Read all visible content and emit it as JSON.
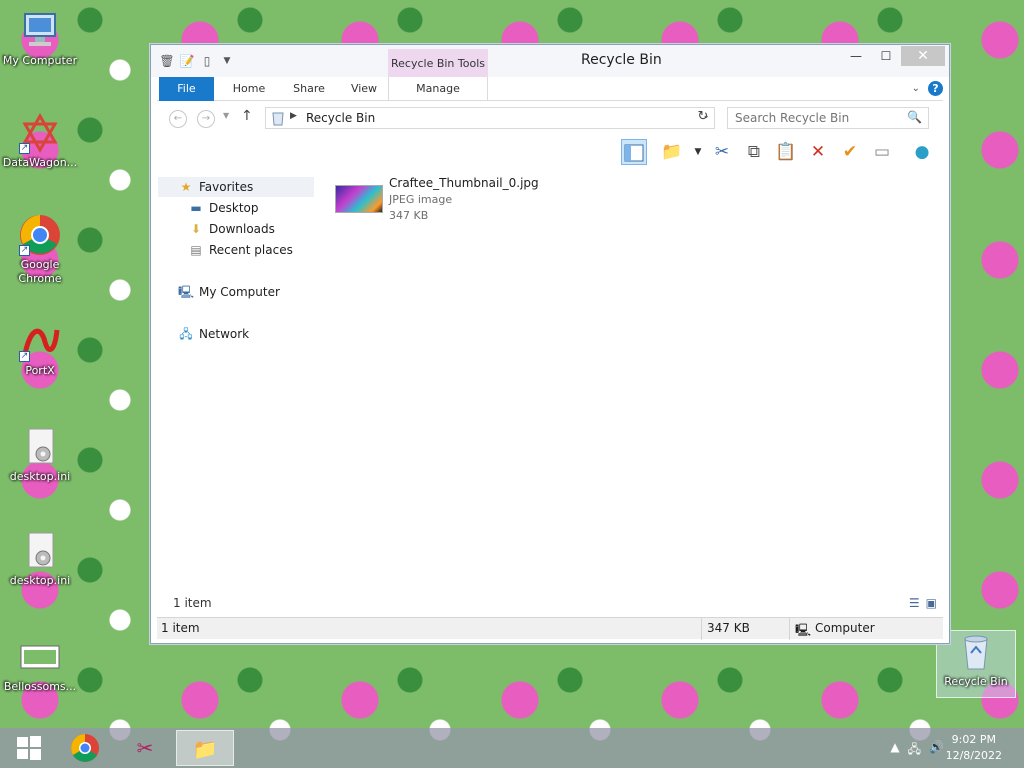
{
  "desktop": {
    "icons": [
      {
        "label": "My Computer"
      },
      {
        "label": "DataWagon..."
      },
      {
        "label": "Google Chrome"
      },
      {
        "label": "PortX"
      },
      {
        "label": "desktop.ini"
      },
      {
        "label": "desktop.ini"
      },
      {
        "label": "Bellossoms..."
      },
      {
        "label": "Recycle Bin"
      }
    ]
  },
  "window": {
    "title": "Recycle Bin",
    "context_tab_group": "Recycle Bin Tools",
    "tabs": [
      "File",
      "Home",
      "Share",
      "View",
      "Manage"
    ],
    "close_glyph": "✕",
    "minimize_glyph": "—",
    "maximize_glyph": "☐",
    "help_glyph": "?",
    "address": {
      "path": "Recycle Bin",
      "back_glyph": "←",
      "forward_glyph": "→",
      "up_glyph": "↑",
      "refresh_glyph": "↻"
    },
    "search": {
      "placeholder": "Search Recycle Bin"
    },
    "nav_pane": {
      "favorites": "Favorites",
      "favorites_items": [
        "Desktop",
        "Downloads",
        "Recent places"
      ],
      "computer": "My Computer",
      "network": "Network"
    },
    "files": [
      {
        "name": "Craftee_Thumbnail_0.jpg",
        "type": "JPEG image",
        "size": "347 KB"
      }
    ],
    "item_count": "1 item",
    "status": {
      "items": "1 item",
      "size": "347 KB",
      "location": "Computer"
    }
  },
  "taskbar": {
    "time": "9:02 PM",
    "date": "12/8/2022"
  },
  "colors": {
    "accent": "#1979ca",
    "context_tab": "#eed8f0",
    "desktop_green": "#7dbd6a",
    "desktop_pink": "#e85dc0"
  }
}
